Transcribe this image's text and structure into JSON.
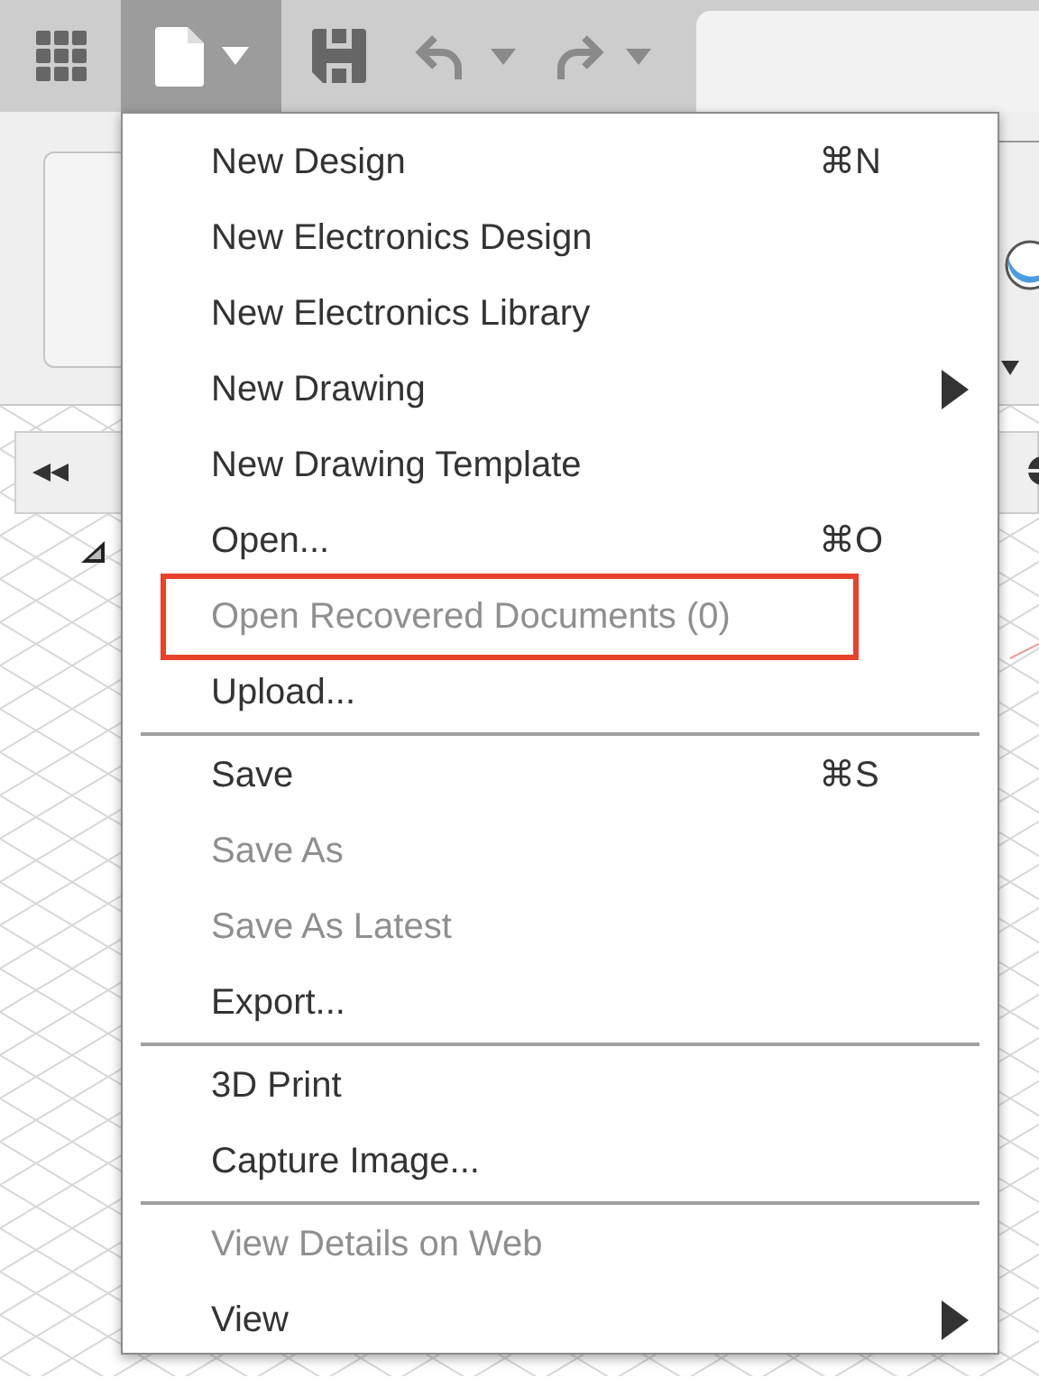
{
  "toolbar": {
    "file_button": {
      "selected": true
    }
  },
  "file_menu": {
    "items": [
      {
        "kind": "item",
        "label": "New Design",
        "shortcut": "⌘N",
        "disabled": false,
        "submenu": false,
        "highlighted": false
      },
      {
        "kind": "item",
        "label": "New Electronics Design",
        "disabled": false,
        "submenu": false,
        "highlighted": false
      },
      {
        "kind": "item",
        "label": "New Electronics Library",
        "disabled": false,
        "submenu": false,
        "highlighted": false
      },
      {
        "kind": "item",
        "label": "New Drawing",
        "disabled": false,
        "submenu": true,
        "highlighted": false
      },
      {
        "kind": "item",
        "label": "New Drawing Template",
        "disabled": false,
        "submenu": false,
        "highlighted": false
      },
      {
        "kind": "item",
        "label": "Open...",
        "shortcut": "⌘O",
        "disabled": false,
        "submenu": false,
        "highlighted": false
      },
      {
        "kind": "item",
        "label": "Open Recovered Documents (0)",
        "disabled": true,
        "submenu": false,
        "highlighted": true
      },
      {
        "kind": "item",
        "label": "Upload...",
        "disabled": false,
        "submenu": false,
        "highlighted": false
      },
      {
        "kind": "separator"
      },
      {
        "kind": "item",
        "label": "Save",
        "shortcut": "⌘S",
        "disabled": false,
        "submenu": false,
        "highlighted": false
      },
      {
        "kind": "item",
        "label": "Save As",
        "disabled": true,
        "submenu": false,
        "highlighted": false
      },
      {
        "kind": "item",
        "label": "Save As Latest",
        "disabled": true,
        "submenu": false,
        "highlighted": false
      },
      {
        "kind": "item",
        "label": "Export...",
        "disabled": false,
        "submenu": false,
        "highlighted": false
      },
      {
        "kind": "separator"
      },
      {
        "kind": "item",
        "label": "3D Print",
        "disabled": false,
        "submenu": false,
        "highlighted": false
      },
      {
        "kind": "item",
        "label": "Capture Image...",
        "disabled": false,
        "submenu": false,
        "highlighted": false
      },
      {
        "kind": "separator"
      },
      {
        "kind": "item",
        "label": "View Details on Web",
        "disabled": true,
        "submenu": false,
        "highlighted": false
      },
      {
        "kind": "item",
        "label": "View",
        "disabled": false,
        "submenu": true,
        "highlighted": false
      }
    ]
  }
}
